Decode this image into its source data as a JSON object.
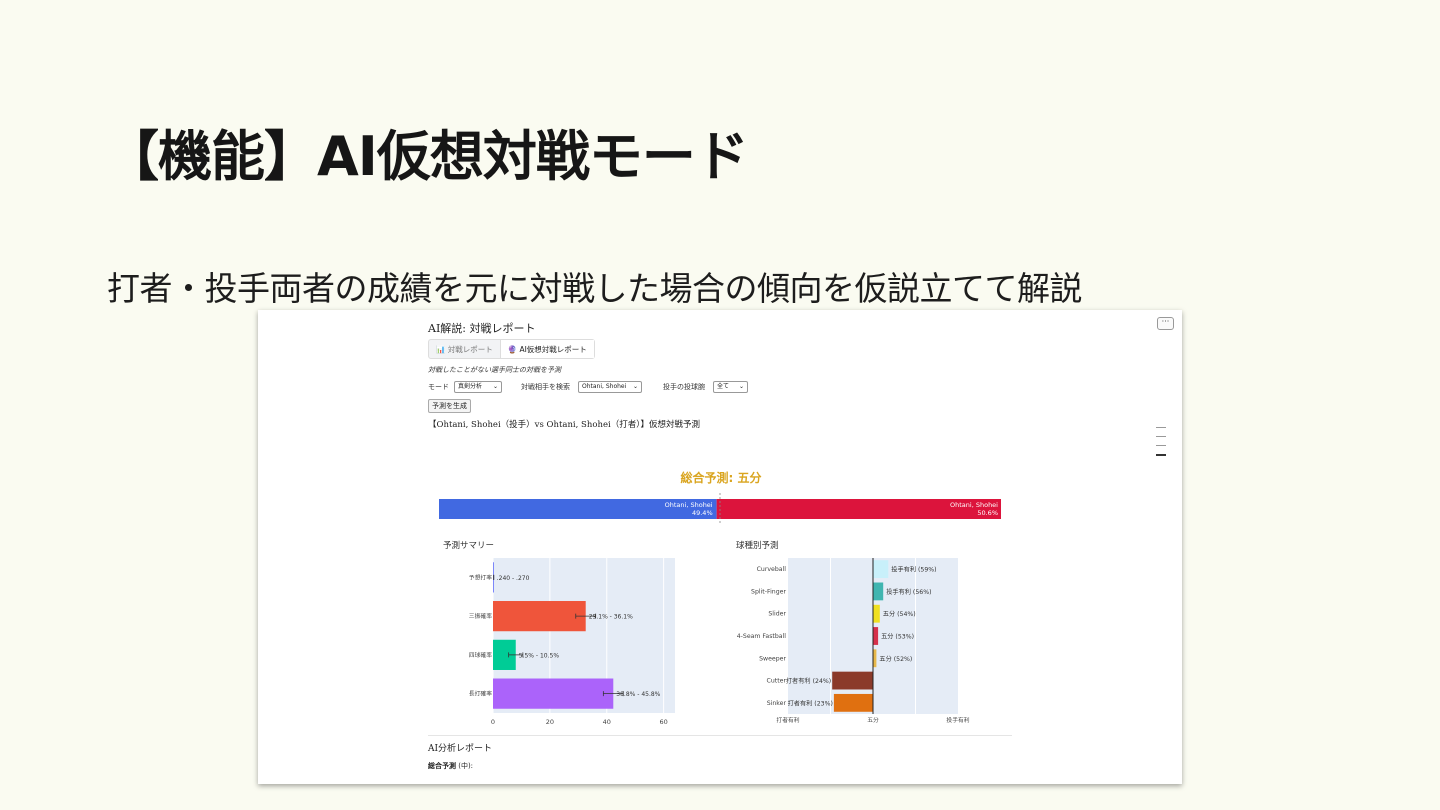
{
  "slide": {
    "title": "【機能】AI仮想対戦モード",
    "subtitle": "打者・投手両者の成績を元に対戦した場合の傾向を仮説立てて解説"
  },
  "app": {
    "heading": "AI解説: 対戦レポート",
    "menu_label": "···",
    "tabs": [
      {
        "label": "📊 対戦レポート",
        "active": false
      },
      {
        "label": "🔮 AI仮想対戦レポート",
        "active": true
      }
    ],
    "description": "対戦したことがない選手同士の対戦を予測",
    "controls": {
      "mode_label": "モード",
      "mode_value": "真剣分析",
      "opponent_label": "対戦相手を検索",
      "opponent_value": "Ohtani, Shohei",
      "pitch_label": "投手の投球腕",
      "pitch_value": "全て",
      "generate_button": "予測を生成"
    },
    "matchup_title": "【Ohtani, Shohei（投手）vs Ohtani, Shohei（打者）】仮想対戦予測",
    "report_heading": "AI分析レポート",
    "report_first_label": "総合予測",
    "report_first_value": " (中):"
  },
  "overall": {
    "title": "総合予測: 五分",
    "left_name": "Ohtani, Shohei",
    "left_pct_text": "49.4%",
    "left_pct": 49.4,
    "right_name": "Ohtani, Shohei",
    "right_pct_text": "50.6%",
    "right_pct": 50.6,
    "colors": {
      "left": "#4169e1",
      "right": "#dc143c",
      "title": "#daa520"
    }
  },
  "chart_data": [
    {
      "type": "bar",
      "orientation": "horizontal",
      "title": "予測サマリー",
      "categories": [
        "予想打率",
        "三振確率",
        "四球確率",
        "長打確率"
      ],
      "values": [
        0.255,
        32.6,
        8.0,
        42.3
      ],
      "error_low": [
        0.24,
        29.1,
        5.5,
        38.8
      ],
      "error_high": [
        0.27,
        36.1,
        10.5,
        45.8
      ],
      "labels": [
        ".240 - .270",
        "29.1% - 36.1%",
        "5.5% - 10.5%",
        "38.8% - 45.8%"
      ],
      "colors": [
        "#636efa",
        "#ef553b",
        "#00cc96",
        "#ab63fa"
      ],
      "xlim": [
        0,
        64
      ],
      "xticks": [
        0,
        20,
        40,
        60
      ],
      "grid": true
    },
    {
      "type": "bar",
      "orientation": "horizontal",
      "title": "球種別予測",
      "categories": [
        "Curveball",
        "Split-Finger",
        "Slider",
        "4-Seam Fastball",
        "Sweeper",
        "Cutter",
        "Sinker"
      ],
      "values": [
        9,
        6,
        4,
        3,
        2,
        -24,
        -23
      ],
      "labels": [
        "投手有利 (59%)",
        "投手有利 (56%)",
        "五分 (54%)",
        "五分 (53%)",
        "五分 (52%)",
        "打者有利 (24%)",
        "打者有利 (23%)"
      ],
      "colors": [
        "#c8f0fa",
        "#40b5b0",
        "#f0e020",
        "#d6304a",
        "#e8b84a",
        "#8b3a2a",
        "#e07010"
      ],
      "xlim": [
        -50,
        50
      ],
      "xtick_labels": [
        "打者有利",
        "五分",
        "投手有利"
      ],
      "grid": true
    }
  ]
}
